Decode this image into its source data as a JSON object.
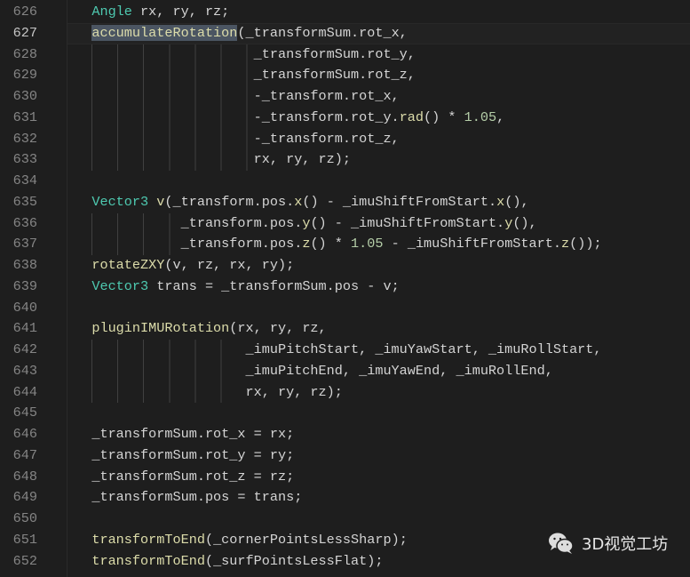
{
  "editor": {
    "active_line": 627,
    "selection": {
      "line": 627,
      "text": "accumulateRotation"
    },
    "lines": [
      {
        "n": "626",
        "tokens": [
          [
            "txt",
            "   "
          ],
          [
            "type",
            "Angle"
          ],
          [
            "txt",
            " rx, ry, rz;"
          ]
        ]
      },
      {
        "n": "627",
        "tokens": [
          [
            "txt",
            "   "
          ],
          [
            "fn",
            "accumulateRotation"
          ],
          [
            "txt",
            "(_transformSum.rot_x,"
          ]
        ]
      },
      {
        "n": "628",
        "tokens": [
          [
            "txt",
            "                       _transformSum.rot_y,"
          ]
        ]
      },
      {
        "n": "629",
        "tokens": [
          [
            "txt",
            "                       _transformSum.rot_z,"
          ]
        ]
      },
      {
        "n": "630",
        "tokens": [
          [
            "txt",
            "                       -_transform.rot_x,"
          ]
        ]
      },
      {
        "n": "631",
        "tokens": [
          [
            "txt",
            "                       -_transform.rot_y."
          ],
          [
            "fn",
            "rad"
          ],
          [
            "txt",
            "() * "
          ],
          [
            "num",
            "1.05"
          ],
          [
            "txt",
            ","
          ]
        ]
      },
      {
        "n": "632",
        "tokens": [
          [
            "txt",
            "                       -_transform.rot_z,"
          ]
        ]
      },
      {
        "n": "633",
        "tokens": [
          [
            "txt",
            "                       rx, ry, rz);"
          ]
        ]
      },
      {
        "n": "634",
        "tokens": []
      },
      {
        "n": "635",
        "tokens": [
          [
            "txt",
            "   "
          ],
          [
            "type",
            "Vector3"
          ],
          [
            "txt",
            " "
          ],
          [
            "fn",
            "v"
          ],
          [
            "txt",
            "(_transform.pos."
          ],
          [
            "fn",
            "x"
          ],
          [
            "txt",
            "() - _imuShiftFromStart."
          ],
          [
            "fn",
            "x"
          ],
          [
            "txt",
            "(),"
          ]
        ]
      },
      {
        "n": "636",
        "tokens": [
          [
            "txt",
            "              _transform.pos."
          ],
          [
            "fn",
            "y"
          ],
          [
            "txt",
            "() - _imuShiftFromStart."
          ],
          [
            "fn",
            "y"
          ],
          [
            "txt",
            "(),"
          ]
        ]
      },
      {
        "n": "637",
        "tokens": [
          [
            "txt",
            "              _transform.pos."
          ],
          [
            "fn",
            "z"
          ],
          [
            "txt",
            "() * "
          ],
          [
            "num",
            "1.05"
          ],
          [
            "txt",
            " - _imuShiftFromStart."
          ],
          [
            "fn",
            "z"
          ],
          [
            "txt",
            "());"
          ]
        ]
      },
      {
        "n": "638",
        "tokens": [
          [
            "txt",
            "   "
          ],
          [
            "fn",
            "rotateZXY"
          ],
          [
            "txt",
            "(v, rz, rx, ry);"
          ]
        ]
      },
      {
        "n": "639",
        "tokens": [
          [
            "txt",
            "   "
          ],
          [
            "type",
            "Vector3"
          ],
          [
            "txt",
            " trans = _transformSum.pos - v;"
          ]
        ]
      },
      {
        "n": "640",
        "tokens": []
      },
      {
        "n": "641",
        "tokens": [
          [
            "txt",
            "   "
          ],
          [
            "fn",
            "pluginIMURotation"
          ],
          [
            "txt",
            "(rx, ry, rz,"
          ]
        ]
      },
      {
        "n": "642",
        "tokens": [
          [
            "txt",
            "                      _imuPitchStart, _imuYawStart, _imuRollStart,"
          ]
        ]
      },
      {
        "n": "643",
        "tokens": [
          [
            "txt",
            "                      _imuPitchEnd, _imuYawEnd, _imuRollEnd,"
          ]
        ]
      },
      {
        "n": "644",
        "tokens": [
          [
            "txt",
            "                      rx, ry, rz);"
          ]
        ]
      },
      {
        "n": "645",
        "tokens": [
          [
            "txt",
            "   "
          ]
        ]
      },
      {
        "n": "646",
        "tokens": [
          [
            "txt",
            "   _transformSum.rot_x = rx;"
          ]
        ]
      },
      {
        "n": "647",
        "tokens": [
          [
            "txt",
            "   _transformSum.rot_y = ry;"
          ]
        ]
      },
      {
        "n": "648",
        "tokens": [
          [
            "txt",
            "   _transformSum.rot_z = rz;"
          ]
        ]
      },
      {
        "n": "649",
        "tokens": [
          [
            "txt",
            "   _transformSum.pos = trans;"
          ]
        ]
      },
      {
        "n": "650",
        "tokens": []
      },
      {
        "n": "651",
        "tokens": [
          [
            "txt",
            "   "
          ],
          [
            "fn",
            "transformToEnd"
          ],
          [
            "txt",
            "(_cornerPointsLessSharp);"
          ]
        ]
      },
      {
        "n": "652",
        "tokens": [
          [
            "txt",
            "   "
          ],
          [
            "fn",
            "transformToEnd"
          ],
          [
            "txt",
            "(_surfPointsLessFlat);"
          ]
        ]
      }
    ]
  },
  "watermark": {
    "icon": "wechat-icon",
    "text": "3D视觉工坊"
  }
}
